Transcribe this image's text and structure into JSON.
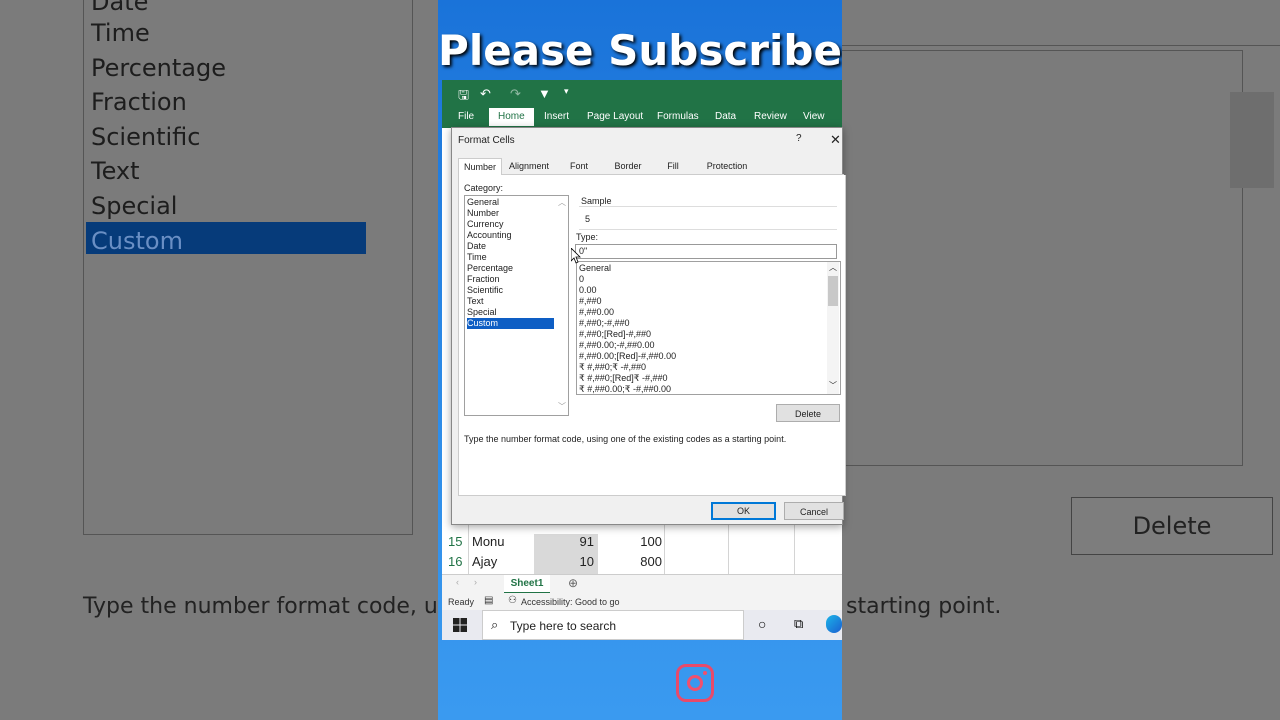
{
  "background_left": {
    "categories": [
      "Date",
      "Time",
      "Percentage",
      "Fraction",
      "Scientific",
      "Text",
      "Special",
      "Custom"
    ],
    "description": "Type the number format code, u"
  },
  "background_right": {
    "delete_label": "Delete",
    "description": "starting point."
  },
  "banner": {
    "text": "Please Subscribe"
  },
  "excel": {
    "tabs": [
      "File",
      "Home",
      "Insert",
      "Page Layout",
      "Formulas",
      "Data",
      "Review",
      "View"
    ],
    "rows": [
      {
        "num": "15",
        "name": "Monu",
        "b": "91",
        "c": "100"
      },
      {
        "num": "16",
        "name": "Ajay",
        "b": "10",
        "c": "800"
      }
    ],
    "sheet_tab": "Sheet1",
    "status": {
      "ready": "Ready",
      "accessibility": "Accessibility: Good to go"
    }
  },
  "taskbar": {
    "search_placeholder": "Type here to search"
  },
  "dialog": {
    "title": "Format Cells",
    "help": "?",
    "close": "✕",
    "tabs": [
      "Number",
      "Alignment",
      "Font",
      "Border",
      "Fill",
      "Protection"
    ],
    "category_label": "Category:",
    "categories": [
      "General",
      "Number",
      "Currency",
      "Accounting",
      "Date",
      "Time",
      "Percentage",
      "Fraction",
      "Scientific",
      "Text",
      "Special",
      "Custom"
    ],
    "selected_category": "Custom",
    "sample_label": "Sample",
    "sample_value": "5",
    "type_label": "Type:",
    "type_value": "0\"",
    "formats": [
      "General",
      "0",
      "0.00",
      "#,##0",
      "#,##0.00",
      "#,##0;-#,##0",
      "#,##0;[Red]-#,##0",
      "#,##0.00;-#,##0.00",
      "#,##0.00;[Red]-#,##0.00",
      "₹ #,##0;₹ -#,##0",
      "₹ #,##0;[Red]₹ -#,##0",
      "₹ #,##0.00;₹ -#,##0.00"
    ],
    "delete_button": "Delete",
    "description": "Type the number format code, using one of the existing codes as a starting point.",
    "ok_button": "OK",
    "cancel_button": "Cancel"
  }
}
